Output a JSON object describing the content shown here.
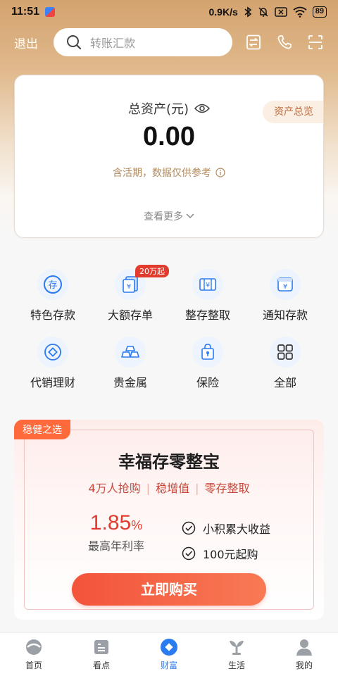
{
  "status_bar": {
    "time": "11:51",
    "network_speed": "0.9K/s",
    "battery": "89"
  },
  "header": {
    "logout_label": "退出",
    "search_placeholder": "转账汇款"
  },
  "asset_card": {
    "title": "总资产(元)",
    "value": "0.00",
    "note": "含活期，数据仅供参考",
    "overview_label": "资产总览",
    "see_more_label": "查看更多"
  },
  "grid": {
    "items": [
      {
        "label": "特色存款",
        "icon": "deposit-icon"
      },
      {
        "label": "大额存单",
        "icon": "certificate-icon",
        "badge": "20万起"
      },
      {
        "label": "整存整取",
        "icon": "lump-sum-icon"
      },
      {
        "label": "通知存款",
        "icon": "notice-deposit-icon"
      },
      {
        "label": "代销理财",
        "icon": "wealth-icon"
      },
      {
        "label": "贵金属",
        "icon": "gold-bars-icon"
      },
      {
        "label": "保险",
        "icon": "insurance-icon"
      },
      {
        "label": "全部",
        "icon": "all-apps-icon"
      }
    ]
  },
  "promo": {
    "tag": "稳健之选",
    "title": "幸福存零整宝",
    "tags": [
      "4万人抢购",
      "稳增值",
      "零存整取"
    ],
    "rate_value": "1.85",
    "rate_unit": "%",
    "rate_label": "最高年利率",
    "features": [
      "小积累大收益",
      "100元起购"
    ],
    "button_label": "立即购买"
  },
  "bottom_nav": {
    "active_index": 2,
    "accent": "#2a7af0",
    "items": [
      {
        "label": "首页",
        "icon": "home-icon"
      },
      {
        "label": "看点",
        "icon": "news-icon"
      },
      {
        "label": "财富",
        "icon": "wealth-nav-icon"
      },
      {
        "label": "生活",
        "icon": "life-icon"
      },
      {
        "label": "我的",
        "icon": "profile-icon"
      }
    ]
  },
  "colors": {
    "header_gradient": "#d4a36f",
    "promo_red": "#e23c2f",
    "promo_orange": "#ff6a3d"
  }
}
